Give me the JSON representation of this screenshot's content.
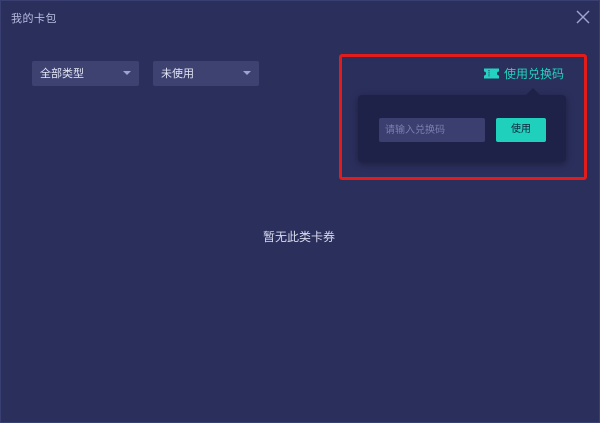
{
  "window": {
    "title": "我的卡包"
  },
  "filters": {
    "type_selected": "全部类型",
    "status_selected": "未使用"
  },
  "redeem": {
    "link_label": "使用兑换码",
    "input_placeholder": "请输入兑换码",
    "input_value": "",
    "button_label": "使用"
  },
  "empty_state": {
    "message": "暂无此类卡券"
  },
  "colors": {
    "background": "#2b2f5c",
    "accent": "#1fd1bd",
    "highlight": "#e21b1b",
    "popover": "#1f2248"
  },
  "icons": {
    "close": "close-icon",
    "caret": "chevron-down-icon",
    "ticket": "ticket-icon"
  }
}
